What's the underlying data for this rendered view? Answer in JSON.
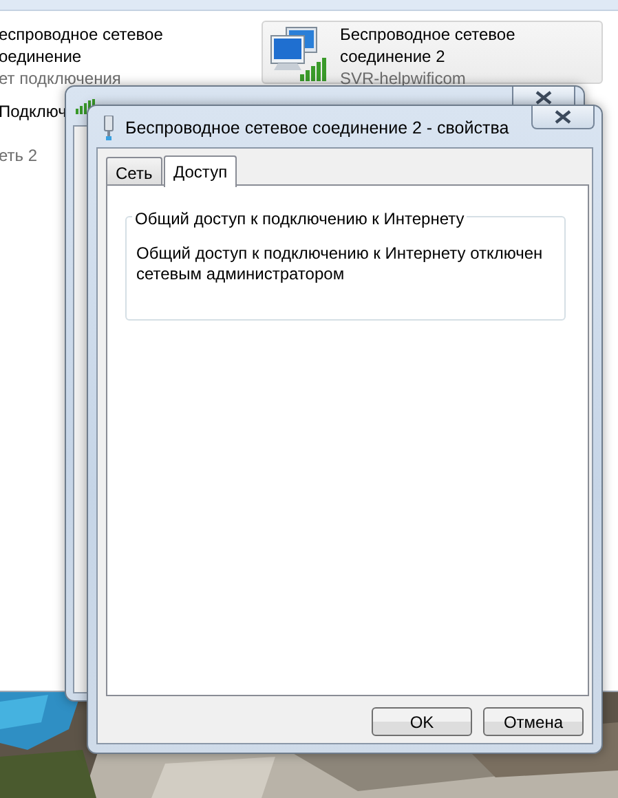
{
  "explorer": {
    "items": [
      {
        "lines": [
          "еспроводное сетевое",
          "оединение"
        ],
        "status": "ет подключения",
        "selected": false
      },
      {
        "lines": [
          "Беспроводное сетевое",
          "соединение 2"
        ],
        "status": "SVR-helpwificom",
        "selected": true
      }
    ],
    "partial_item": {
      "name": "Подключ",
      "status": "еть 2"
    }
  },
  "properties_window": {
    "title": "Беспроводное сетевое соединение 2 - свойства",
    "tabs": [
      {
        "label": "Сеть",
        "selected": false
      },
      {
        "label": "Доступ",
        "selected": true
      }
    ],
    "group": {
      "legend": "Общий доступ к подключению к Интернету",
      "text": "Общий доступ к подключению к Интернету отключен сетевым администратором"
    },
    "buttons": [
      "OK",
      "Отмена"
    ]
  }
}
